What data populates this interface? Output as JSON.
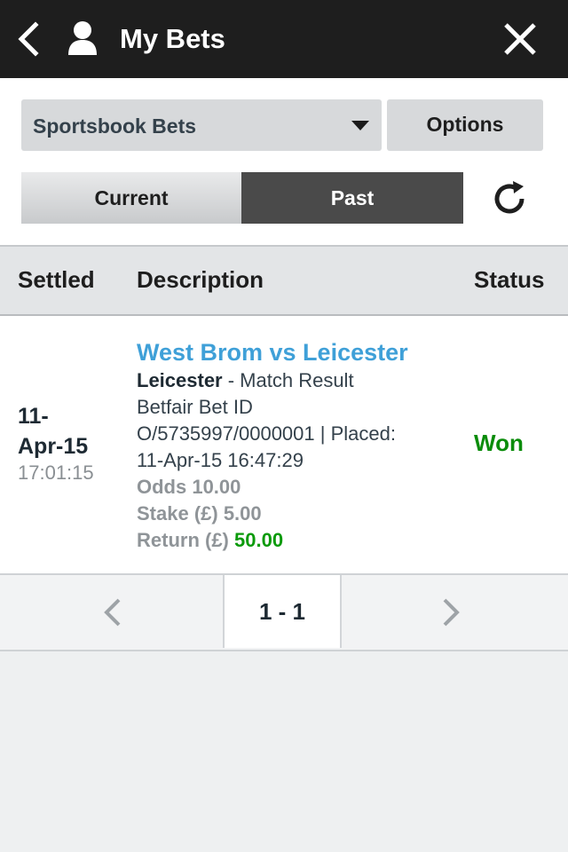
{
  "header": {
    "title": "My Bets",
    "back_icon": "chevron-left-icon",
    "user_icon": "user-icon",
    "close_icon": "close-icon"
  },
  "filters": {
    "bet_type_selected": "Sportsbook Bets",
    "options_label": "Options",
    "tabs": [
      {
        "label": "Current",
        "active": false
      },
      {
        "label": "Past",
        "active": true
      }
    ],
    "refresh_icon": "refresh-icon"
  },
  "table": {
    "columns": [
      "Settled",
      "Description",
      "Status"
    ],
    "rows": [
      {
        "settled_date_line1": "11-",
        "settled_date_line2": "Apr-15",
        "settled_time": "17:01:15",
        "event": "West Brom vs Leicester",
        "selection": "Leicester",
        "market": " - Match Result",
        "bet_id_label": "Betfair Bet ID",
        "bet_id_placed": "O/5735997/0000001 | Placed:",
        "placed_datetime": "11-Apr-15 16:47:29",
        "odds_text": "Odds 10.00",
        "stake_text": "Stake (£) 5.00",
        "return_label": "Return (£) ",
        "return_value": "50.00",
        "status": "Won"
      }
    ]
  },
  "pagination": {
    "range": "1 - 1",
    "prev_icon": "chevron-left-icon",
    "next_icon": "chevron-right-icon"
  },
  "colors": {
    "header_bg": "#1e1e1e",
    "event_link": "#3fa0d8",
    "won": "#0a8c0a",
    "active_tab": "#4a4a4a"
  }
}
